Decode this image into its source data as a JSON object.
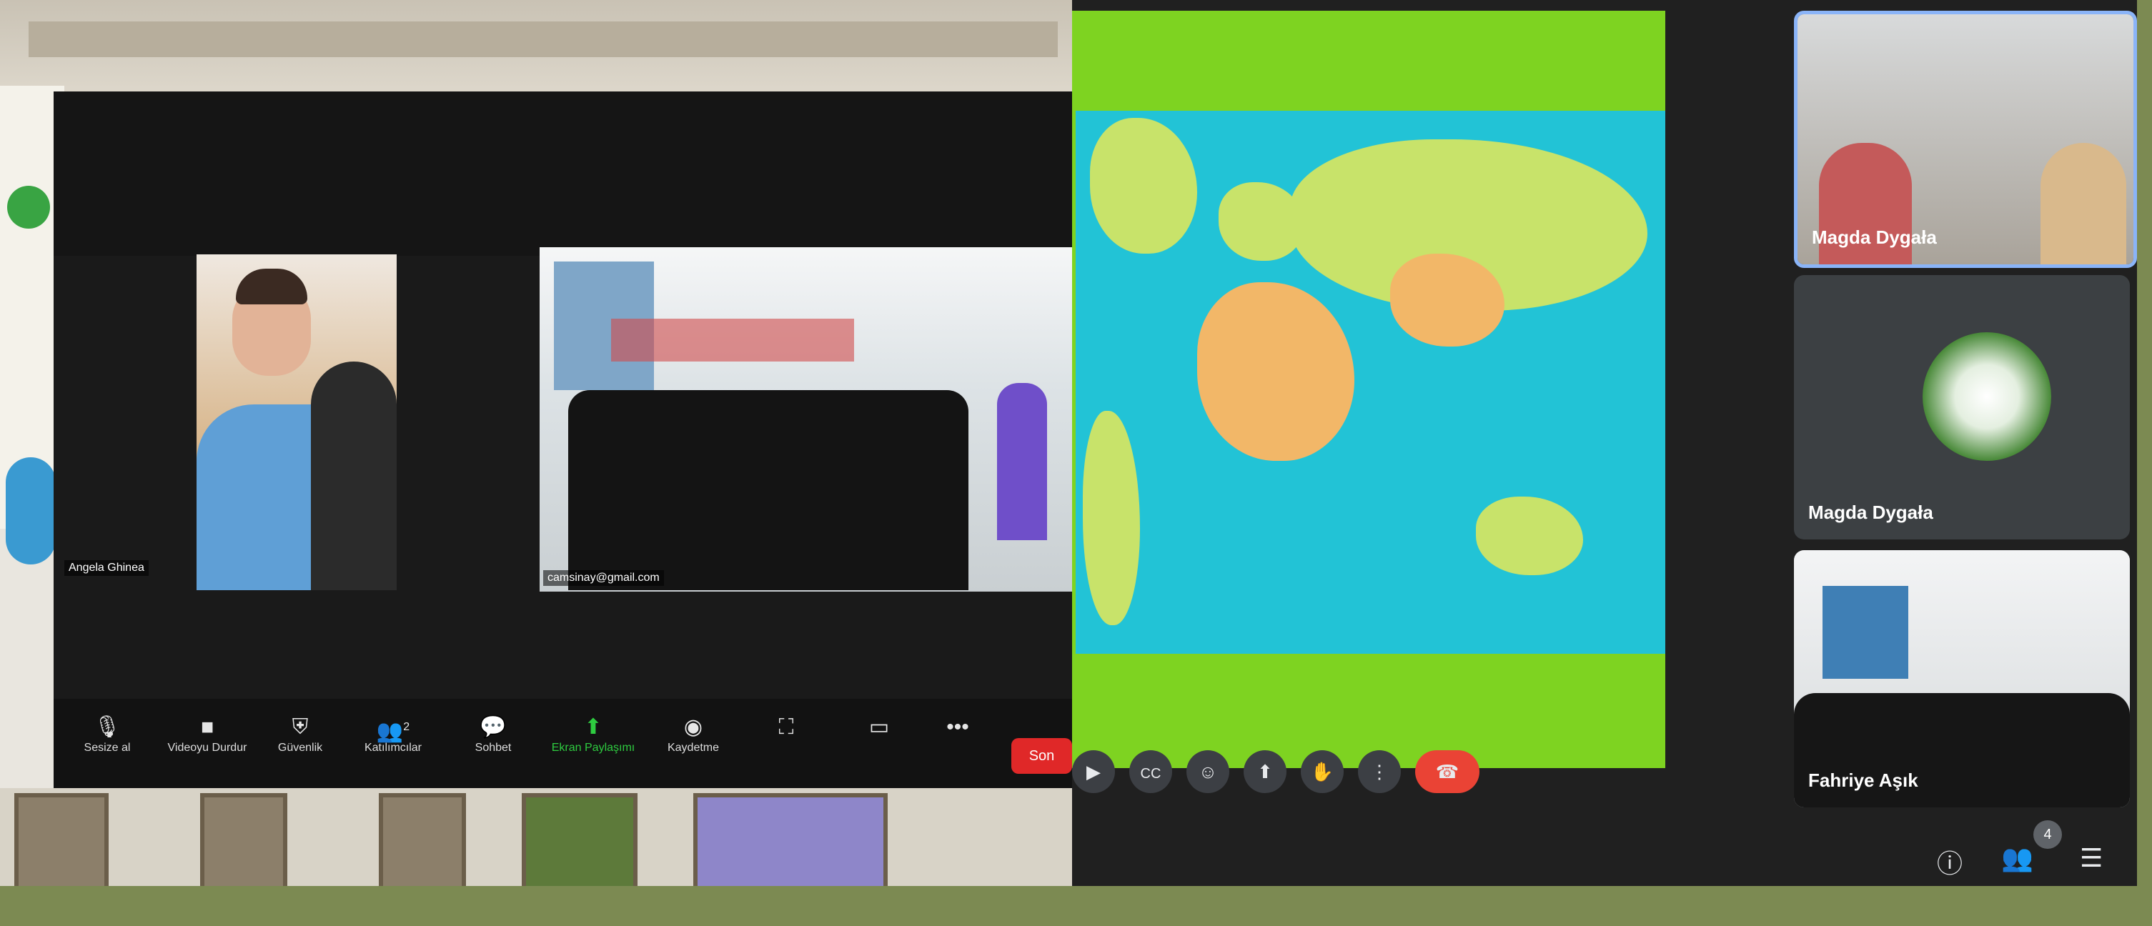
{
  "left_zoom": {
    "participant_1_name": "Angela Ghinea",
    "participant_2_name": "camsinay@gmail.com",
    "toolbar": [
      {
        "icon": "microphone-icon",
        "label": "Sesize al"
      },
      {
        "icon": "video-camera-icon",
        "label": "Videoyu Durdur"
      },
      {
        "icon": "shield-icon",
        "label": "Güvenlik"
      },
      {
        "icon": "participants-icon",
        "label": "Katılımcılar",
        "count": "2"
      },
      {
        "icon": "chat-icon",
        "label": "Sohbet"
      },
      {
        "icon": "share-screen-icon",
        "label": "Ekran Paylaşımı"
      },
      {
        "icon": "record-icon",
        "label": "Kaydetme"
      },
      {
        "icon": "reactions-icon",
        "label": ""
      },
      {
        "icon": "view-icon",
        "label": ""
      },
      {
        "icon": "more-icon",
        "label": "•••"
      }
    ],
    "end_label": "Son"
  },
  "right_meet": {
    "participants": [
      {
        "name": "Magda Dygała"
      },
      {
        "name": "Magda Dygała"
      },
      {
        "name": "Fahriye Aşık"
      }
    ],
    "participant_count": "4",
    "colors": {
      "slide_bg": "#7ed321",
      "map_ocean": "#22c3d6",
      "end_call": "#ea4335"
    }
  },
  "icons": {
    "meet_toolbar": [
      "camera-icon",
      "captions-icon",
      "emoji-icon",
      "present-icon",
      "raise-hand-icon",
      "more-vert-icon",
      "end-call-icon"
    ],
    "meet_corner": [
      "info-icon",
      "people-icon",
      "chat-icon"
    ]
  }
}
